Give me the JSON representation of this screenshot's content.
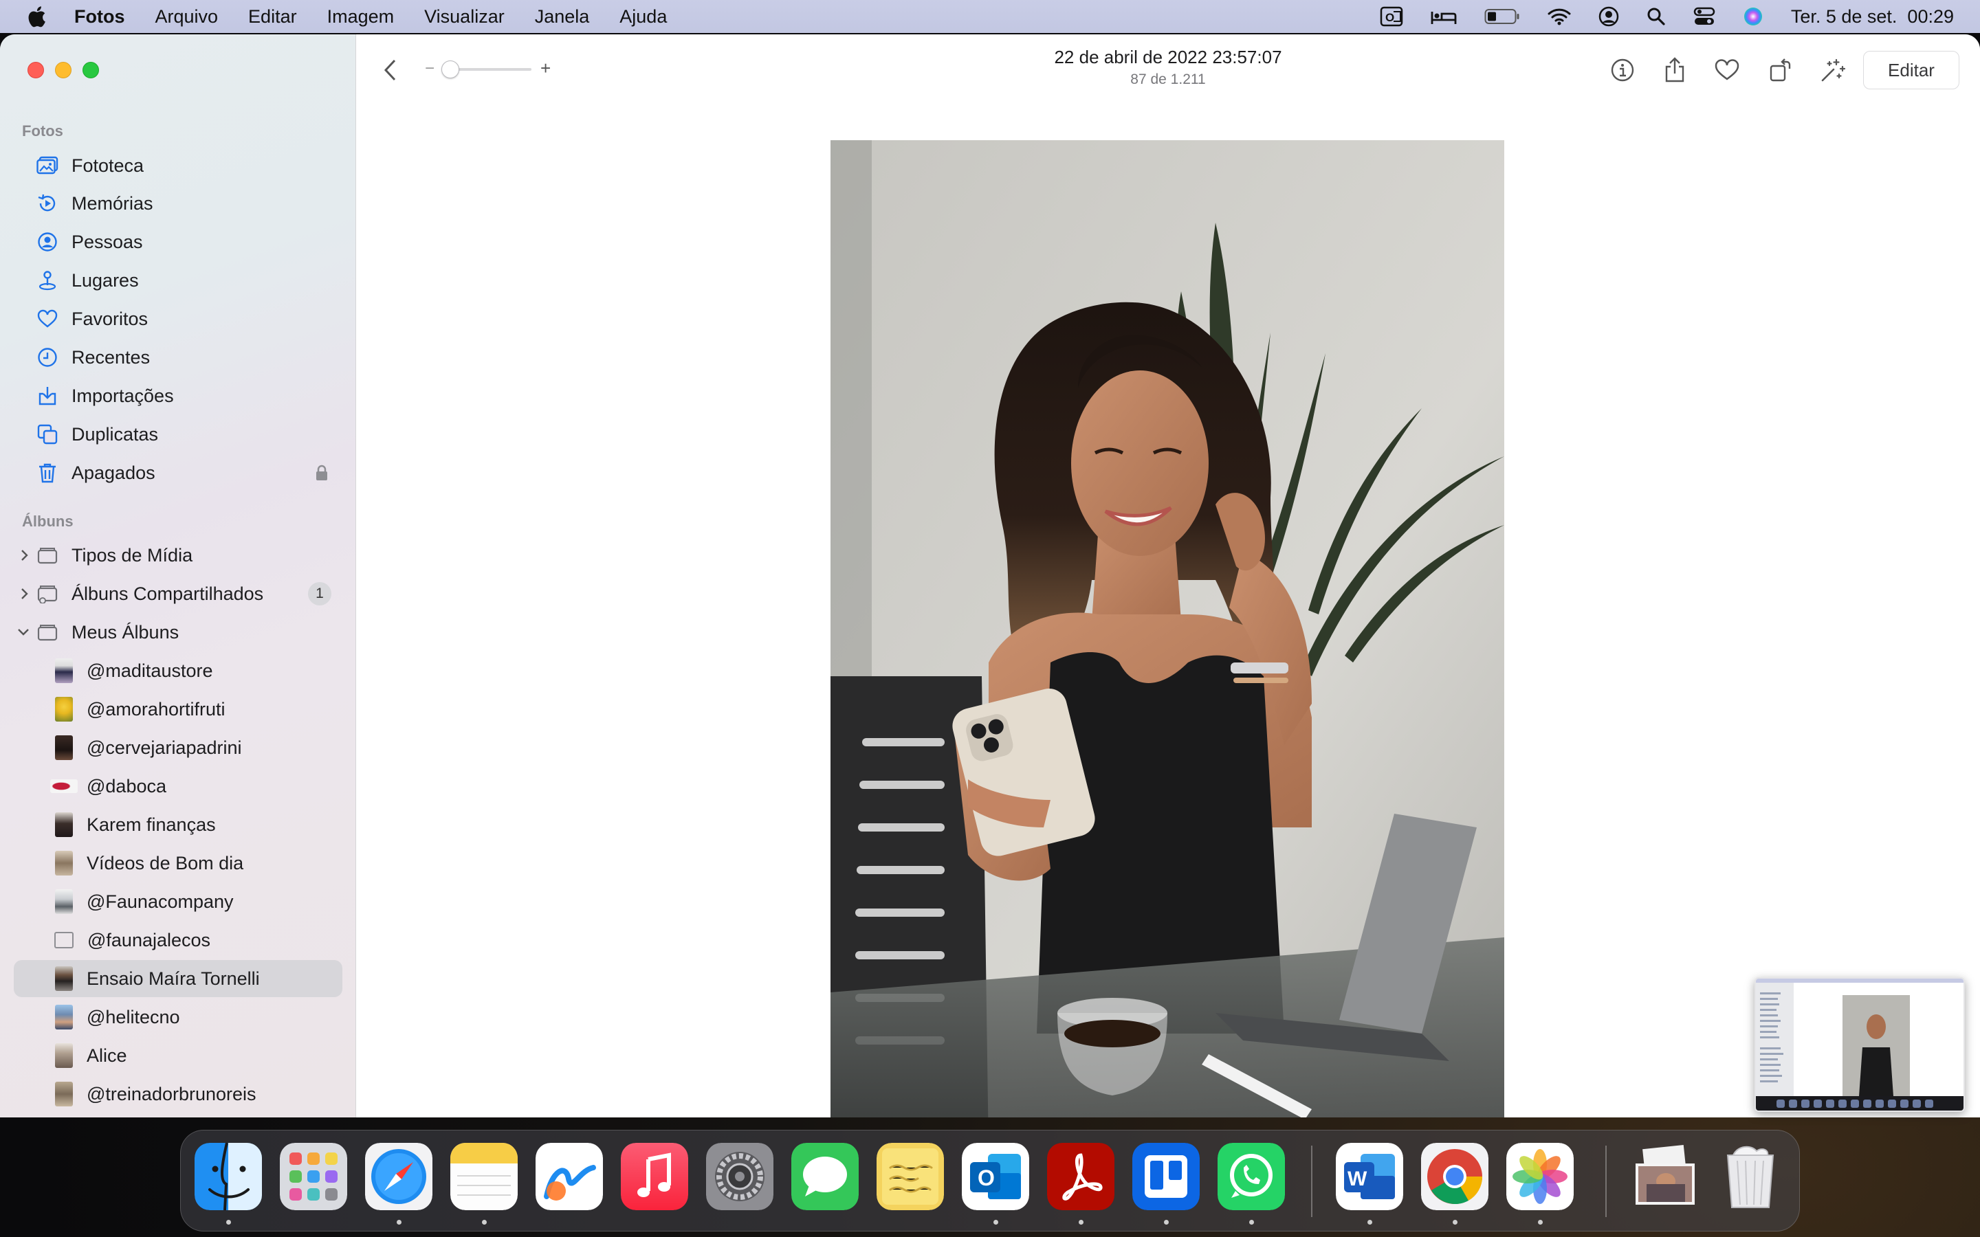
{
  "menubar": {
    "app_name": "Fotos",
    "menus": [
      "Arquivo",
      "Editar",
      "Imagem",
      "Visualizar",
      "Janela",
      "Ajuda"
    ],
    "clock": "Ter. 5 de set.  00:29",
    "status_icons": [
      "outlook-icon",
      "sleep-icon",
      "battery-icon",
      "wifi-icon",
      "user-icon",
      "spotlight-icon",
      "control-center-icon",
      "siri-icon"
    ]
  },
  "sidebar": {
    "section_photos": "Fotos",
    "library_items": [
      {
        "label": "Fototeca",
        "icon": "photo-library-icon"
      },
      {
        "label": "Memórias",
        "icon": "memories-icon"
      },
      {
        "label": "Pessoas",
        "icon": "people-icon"
      },
      {
        "label": "Lugares",
        "icon": "places-icon"
      },
      {
        "label": "Favoritos",
        "icon": "heart-icon"
      },
      {
        "label": "Recentes",
        "icon": "clock-icon"
      },
      {
        "label": "Importações",
        "icon": "import-icon"
      },
      {
        "label": "Duplicatas",
        "icon": "duplicates-icon"
      },
      {
        "label": "Apagados",
        "icon": "trash-icon"
      }
    ],
    "section_albums": "Álbuns",
    "album_groups": [
      {
        "label": "Tipos de Mídia",
        "badge": ""
      },
      {
        "label": "Álbuns Compartilhados",
        "badge": "1"
      },
      {
        "label": "Meus Álbuns",
        "badge": ""
      }
    ],
    "albums": [
      "@maditaustore",
      "@amorahortifruti",
      "@cervejariapadrini",
      "@daboca",
      "Karem finanças",
      "Vídeos de Bom dia",
      "@Faunacompany",
      "@faunajalecos",
      "Ensaio Maíra Tornelli",
      "@helitecno",
      "Alice",
      "@treinadorbrunoreis"
    ],
    "selected_album": "Ensaio Maíra Tornelli"
  },
  "toolbar": {
    "date": "22 de abril de 2022 23:57:07",
    "position": "87 de 1.211",
    "edit_label": "Editar",
    "zoom_minus": "−",
    "zoom_plus": "+"
  },
  "dock": {
    "apps": [
      "Finder",
      "Launchpad",
      "Safari",
      "Notas",
      "Freeform",
      "Música",
      "Ajustes do Sistema",
      "Mensagens",
      "Stickies",
      "Outlook",
      "Acrobat",
      "Trello",
      "WhatsApp",
      "Word",
      "Chrome",
      "Fotos",
      "Downloads",
      "Lixo"
    ]
  }
}
